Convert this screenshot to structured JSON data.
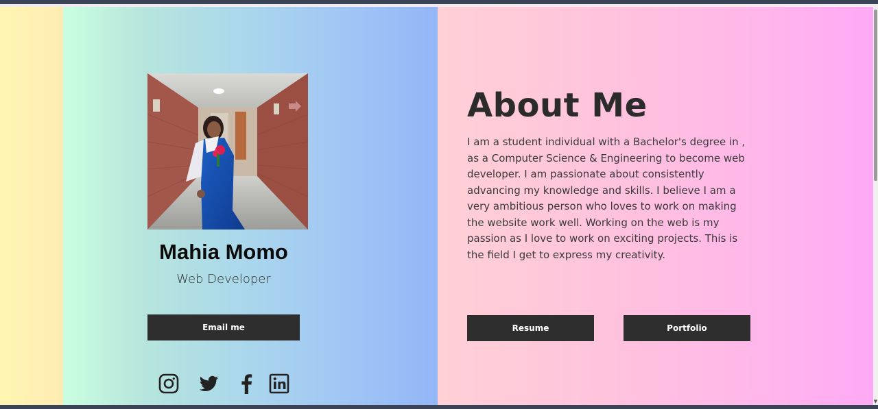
{
  "profile": {
    "name": "Mahia Momo",
    "role": "Web Developer",
    "email_button": "Email me"
  },
  "about": {
    "title": "About Me",
    "text": "I am a student individual with a Bachelor's degree in , as a Computer Science & Engineering to become web developer. I am passionate about consistently advancing my knowledge and skills. I believe I am a very ambitious person who loves to work on making the website work well. Working on the web is my passion as I love to work on exciting projects. This is the field I get to express my creativity."
  },
  "buttons": {
    "resume": "Resume",
    "portfolio": "Portfolio"
  },
  "socials": [
    {
      "icon": "instagram-icon"
    },
    {
      "icon": "twitter-icon"
    },
    {
      "icon": "facebook-icon"
    },
    {
      "icon": "linkedin-icon"
    }
  ],
  "colors": {
    "button_bg": "#2e2e2e",
    "button_text": "#ffffff",
    "heading": "#2b2b2b",
    "body_text": "#3a3a3a"
  }
}
